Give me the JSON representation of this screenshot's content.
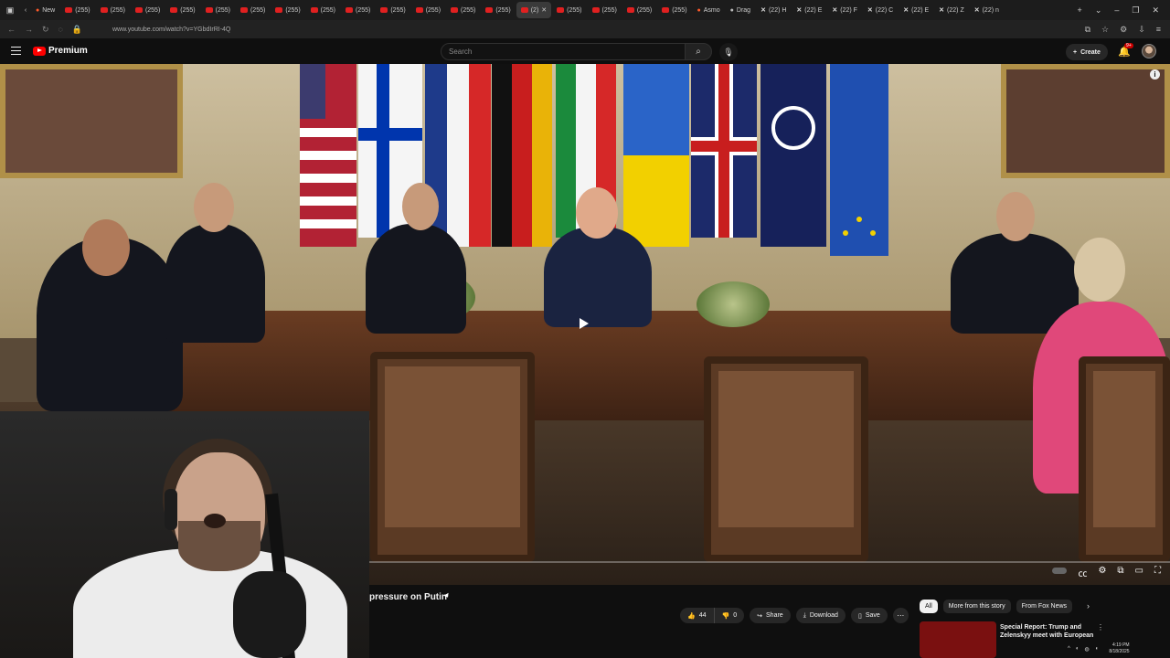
{
  "browser": {
    "tabs": [
      {
        "label": "New",
        "icon": "reddit-icon"
      },
      {
        "label": "(255)",
        "icon": "youtube-icon"
      },
      {
        "label": "(255)",
        "icon": "youtube-icon"
      },
      {
        "label": "(255)",
        "icon": "youtube-icon"
      },
      {
        "label": "(255)",
        "icon": "youtube-icon"
      },
      {
        "label": "(255)",
        "icon": "youtube-icon"
      },
      {
        "label": "(255)",
        "icon": "youtube-icon"
      },
      {
        "label": "(255)",
        "icon": "youtube-icon"
      },
      {
        "label": "(255)",
        "icon": "youtube-icon"
      },
      {
        "label": "(255)",
        "icon": "youtube-icon"
      },
      {
        "label": "(255)",
        "icon": "youtube-icon"
      },
      {
        "label": "(255)",
        "icon": "youtube-icon"
      },
      {
        "label": "(255)",
        "icon": "youtube-icon"
      },
      {
        "label": "(255)",
        "icon": "youtube-icon"
      },
      {
        "label": "(2)",
        "icon": "youtube-icon",
        "active": true
      },
      {
        "label": "(255)",
        "icon": "youtube-icon"
      },
      {
        "label": "(255)",
        "icon": "youtube-icon"
      },
      {
        "label": "(255)",
        "icon": "youtube-icon"
      },
      {
        "label": "(255)",
        "icon": "youtube-icon"
      },
      {
        "label": "Asmo",
        "icon": "reddit-icon"
      },
      {
        "label": "Drag",
        "icon": "site-icon"
      },
      {
        "label": "(22) H",
        "icon": "x-icon"
      },
      {
        "label": "(22) E",
        "icon": "x-icon"
      },
      {
        "label": "(22) F",
        "icon": "x-icon"
      },
      {
        "label": "(22) C",
        "icon": "x-icon"
      },
      {
        "label": "(22) E",
        "icon": "x-icon"
      },
      {
        "label": "(22) Z",
        "icon": "x-icon"
      },
      {
        "label": "(22) n",
        "icon": "x-icon"
      }
    ],
    "url": "www.youtube.com/watch?v=YGbdIrRI-4Q"
  },
  "youtube": {
    "brand": "Premium",
    "search_placeholder": "Search",
    "create_label": "Create",
    "notif_count": "9+"
  },
  "video": {
    "title_visible": "pressure on Putin",
    "like_count": "44",
    "dislike_count": "0",
    "share_label": "Share",
    "download_label": "Download",
    "save_label": "Save"
  },
  "sidebar": {
    "chips": [
      "All",
      "More from this story",
      "From Fox News"
    ],
    "recommendation_title": "Special Report: Trump and Zelenskyy meet with European"
  },
  "taskbar": {
    "time": "4:19 PM",
    "date": "8/18/2025"
  },
  "colors": {
    "youtube_red": "#ff0000",
    "background": "#0f0f0f",
    "chip_bg": "#272727"
  }
}
